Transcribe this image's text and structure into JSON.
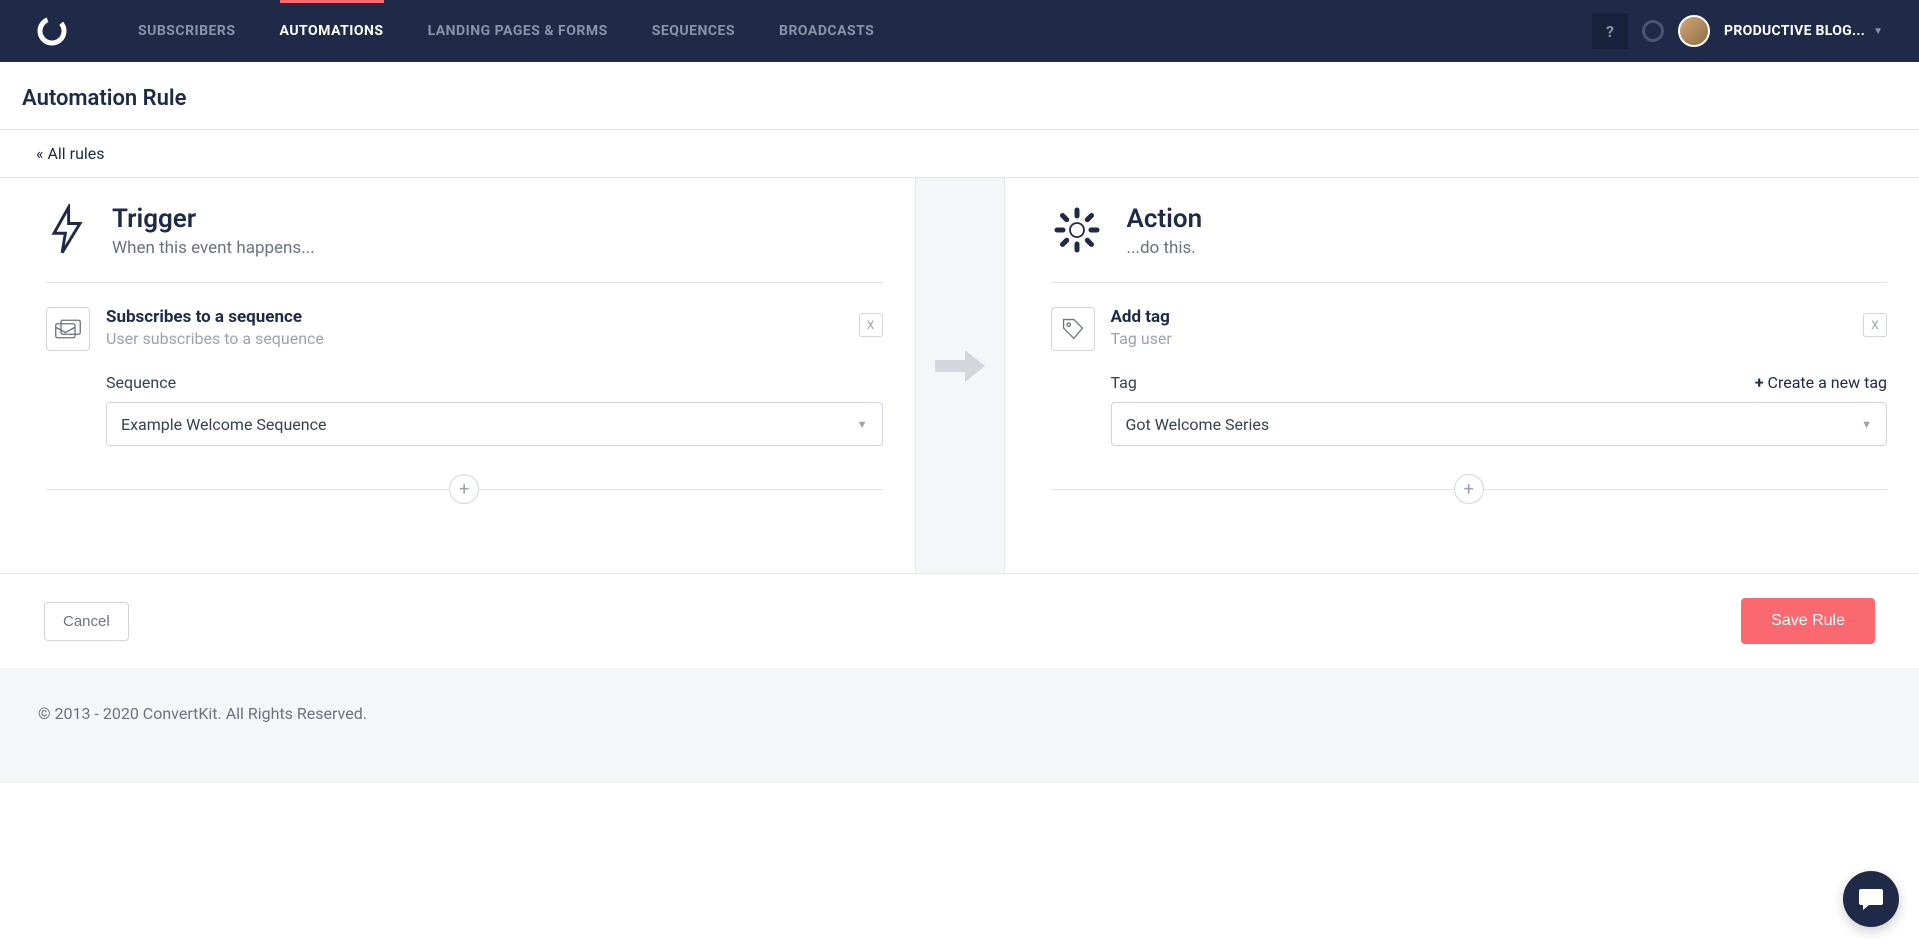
{
  "nav": {
    "items": [
      "SUBSCRIBERS",
      "AUTOMATIONS",
      "LANDING PAGES & FORMS",
      "SEQUENCES",
      "BROADCASTS"
    ],
    "help": "?",
    "username": "PRODUCTIVE BLOG..."
  },
  "page": {
    "title": "Automation Rule",
    "breadcrumb": "« All rules"
  },
  "trigger": {
    "title": "Trigger",
    "subtitle": "When this event happens...",
    "card": {
      "title": "Subscribes to a sequence",
      "subtitle": "User subscribes to a sequence",
      "remove": "X",
      "field_label": "Sequence",
      "field_value": "Example Welcome Sequence"
    },
    "add": "+"
  },
  "action": {
    "title": "Action",
    "subtitle": "...do this.",
    "card": {
      "title": "Add tag",
      "subtitle": "Tag user",
      "remove": "X",
      "field_label": "Tag",
      "create_link": "Create a new tag",
      "field_value": "Got Welcome Series"
    },
    "add": "+"
  },
  "footer_actions": {
    "cancel": "Cancel",
    "save": "Save Rule"
  },
  "site_footer": "© 2013 - 2020 ConvertKit. All Rights Reserved."
}
